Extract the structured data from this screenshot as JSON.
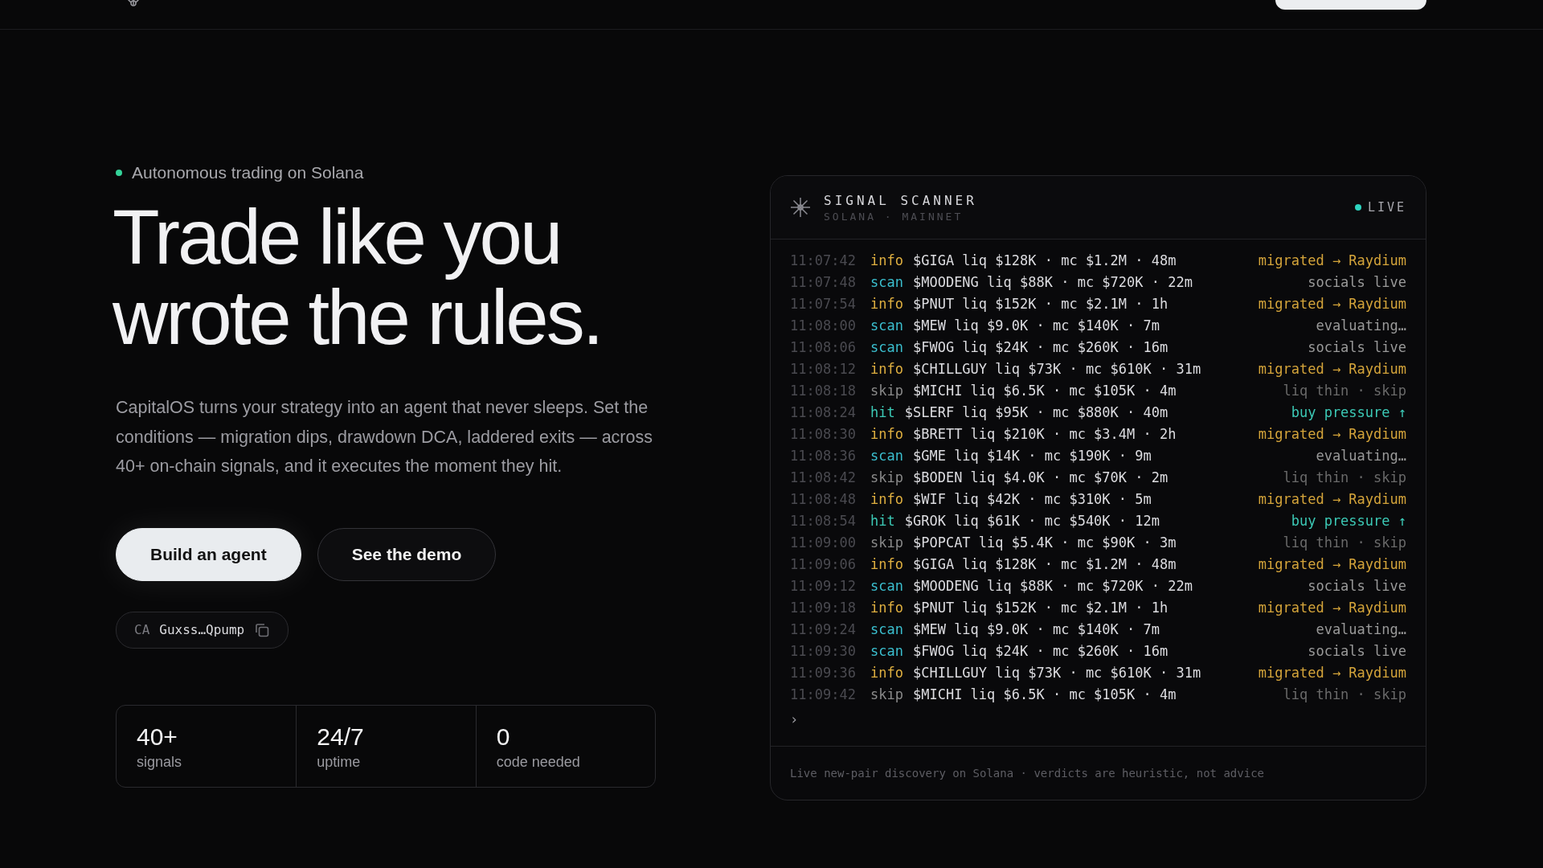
{
  "hero": {
    "eyebrow": "Autonomous trading on Solana",
    "title_lines": [
      "Trade like you",
      "wrote the rules."
    ],
    "description": "CapitalOS turns your strategy into an agent that never sleeps. Set the conditions — migration dips, drawdown DCA, laddered exits — across 40+ on-chain signals, and it executes the moment they hit.",
    "buttons": [
      {
        "label": "Build an agent",
        "kind": "primary"
      },
      {
        "label": "See the demo",
        "kind": "secondary"
      }
    ],
    "contract": {
      "label": "CA",
      "address": "Guxss…Qpump"
    },
    "stats": [
      {
        "value": "40+",
        "label": "signals"
      },
      {
        "value": "24/7",
        "label": "uptime"
      },
      {
        "value": "0",
        "label": "code needed"
      }
    ]
  },
  "scanner": {
    "title": "SIGNAL SCANNER",
    "subtitle": "SOLANA · MAINNET",
    "status": "LIVE",
    "rows": [
      {
        "time": "11:07:42",
        "kind": "info",
        "text": "$GIGA liq $128K · mc $1.2M · 48m",
        "verdict": "migrated → Raydium"
      },
      {
        "time": "11:07:48",
        "kind": "scan",
        "text": "$MOODENG liq $88K · mc $720K · 22m",
        "verdict": "socials live"
      },
      {
        "time": "11:07:54",
        "kind": "info",
        "text": "$PNUT liq $152K · mc $2.1M · 1h",
        "verdict": "migrated → Raydium"
      },
      {
        "time": "11:08:00",
        "kind": "scan",
        "text": "$MEW liq $9.0K · mc $140K · 7m",
        "verdict": "evaluating…"
      },
      {
        "time": "11:08:06",
        "kind": "scan",
        "text": "$FWOG liq $24K · mc $260K · 16m",
        "verdict": "socials live"
      },
      {
        "time": "11:08:12",
        "kind": "info",
        "text": "$CHILLGUY liq $73K · mc $610K · 31m",
        "verdict": "migrated → Raydium"
      },
      {
        "time": "11:08:18",
        "kind": "skip",
        "text": "$MICHI liq $6.5K · mc $105K · 4m",
        "verdict": "liq thin · skip"
      },
      {
        "time": "11:08:24",
        "kind": "hit",
        "text": "$SLERF liq $95K · mc $880K · 40m",
        "verdict": "buy pressure ↑"
      },
      {
        "time": "11:08:30",
        "kind": "info",
        "text": "$BRETT liq $210K · mc $3.4M · 2h",
        "verdict": "migrated → Raydium"
      },
      {
        "time": "11:08:36",
        "kind": "scan",
        "text": "$GME liq $14K · mc $190K · 9m",
        "verdict": "evaluating…"
      },
      {
        "time": "11:08:42",
        "kind": "skip",
        "text": "$BODEN liq $4.0K · mc $70K · 2m",
        "verdict": "liq thin · skip"
      },
      {
        "time": "11:08:48",
        "kind": "info",
        "text": "$WIF liq $42K · mc $310K · 5m",
        "verdict": "migrated → Raydium"
      },
      {
        "time": "11:08:54",
        "kind": "hit",
        "text": "$GROK liq $61K · mc $540K · 12m",
        "verdict": "buy pressure ↑"
      },
      {
        "time": "11:09:00",
        "kind": "skip",
        "text": "$POPCAT liq $5.4K · mc $90K · 3m",
        "verdict": "liq thin · skip"
      },
      {
        "time": "11:09:06",
        "kind": "info",
        "text": "$GIGA liq $128K · mc $1.2M · 48m",
        "verdict": "migrated → Raydium"
      },
      {
        "time": "11:09:12",
        "kind": "scan",
        "text": "$MOODENG liq $88K · mc $720K · 22m",
        "verdict": "socials live"
      },
      {
        "time": "11:09:18",
        "kind": "info",
        "text": "$PNUT liq $152K · mc $2.1M · 1h",
        "verdict": "migrated → Raydium"
      },
      {
        "time": "11:09:24",
        "kind": "scan",
        "text": "$MEW liq $9.0K · mc $140K · 7m",
        "verdict": "evaluating…"
      },
      {
        "time": "11:09:30",
        "kind": "scan",
        "text": "$FWOG liq $24K · mc $260K · 16m",
        "verdict": "socials live"
      },
      {
        "time": "11:09:36",
        "kind": "info",
        "text": "$CHILLGUY liq $73K · mc $610K · 31m",
        "verdict": "migrated → Raydium"
      },
      {
        "time": "11:09:42",
        "kind": "skip",
        "text": "$MICHI liq $6.5K · mc $105K · 4m",
        "verdict": "liq thin · skip"
      }
    ],
    "prompt": "›",
    "footer": "Live new-pair discovery on Solana · verdicts are heuristic, not advice"
  }
}
